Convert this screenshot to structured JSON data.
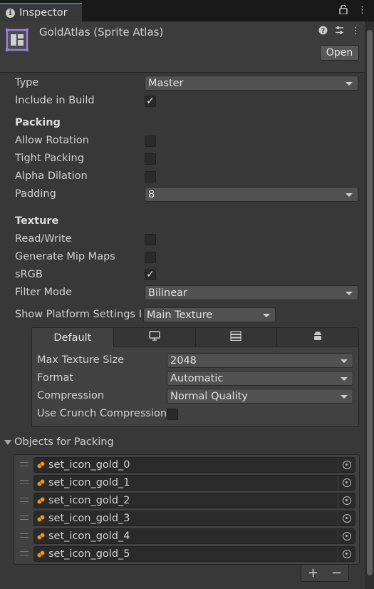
{
  "window": {
    "tab_label": "Inspector"
  },
  "header": {
    "title": "GoldAtlas (Sprite Atlas)",
    "open_label": "Open"
  },
  "main": {
    "type_label": "Type",
    "type_value": "Master",
    "include_label": "Include in Build",
    "include_checked": true,
    "packing_heading": "Packing",
    "allow_rotation_label": "Allow Rotation",
    "tight_packing_label": "Tight Packing",
    "alpha_dilation_label": "Alpha Dilation",
    "padding_label": "Padding",
    "padding_value": "8",
    "texture_heading": "Texture",
    "readwrite_label": "Read/Write",
    "mipmaps_label": "Generate Mip Maps",
    "srgb_label": "sRGB",
    "srgb_checked": true,
    "filter_label": "Filter Mode",
    "filter_value": "Bilinear",
    "platform_settings_label": "Show Platform Settings I",
    "platform_settings_value": "Main Texture"
  },
  "platform": {
    "tabs": [
      "Default",
      "standalone-icon",
      "server-icon",
      "android-icon"
    ],
    "max_size_label": "Max Texture Size",
    "max_size_value": "2048",
    "format_label": "Format",
    "format_value": "Automatic",
    "compression_label": "Compression",
    "compression_value": "Normal Quality",
    "crunch_label": "Use Crunch Compression"
  },
  "objects": {
    "heading": "Objects for Packing",
    "items": [
      "set_icon_gold_0",
      "set_icon_gold_1",
      "set_icon_gold_2",
      "set_icon_gold_3",
      "set_icon_gold_4",
      "set_icon_gold_5"
    ],
    "add_label": "+",
    "remove_label": "−"
  },
  "colors": {
    "accent": "#3a79bb",
    "atlas_icon": "#9b7fe0",
    "gold": "#e6a22b"
  }
}
